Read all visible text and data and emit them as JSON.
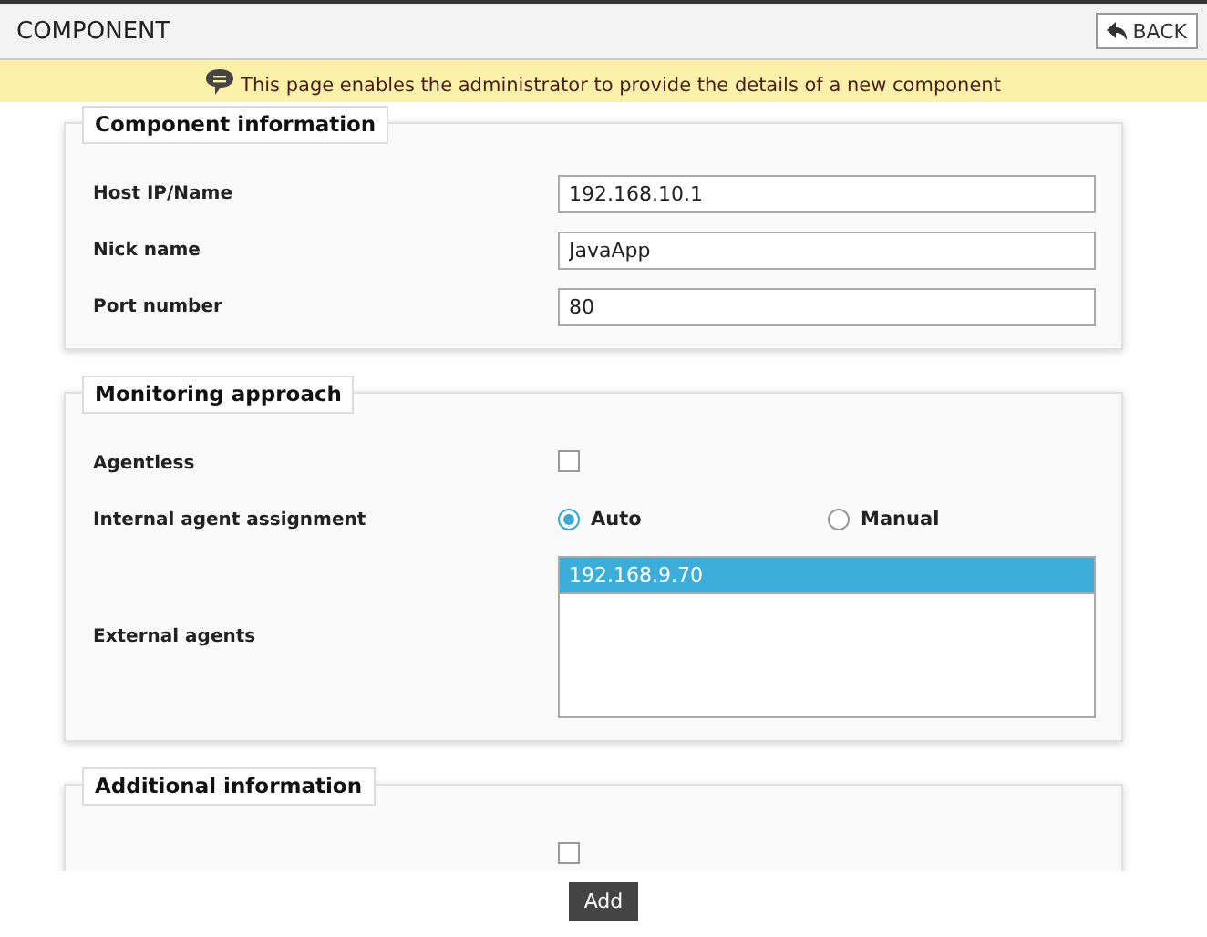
{
  "header": {
    "title": "COMPONENT",
    "back_button": "BACK"
  },
  "banner": {
    "message": "This page enables the administrator to provide the details of a new component"
  },
  "sections": [
    {
      "title": "Component information",
      "rows": [
        {
          "kind": "text",
          "label": "Host IP/Name",
          "value": "192.168.10.1"
        },
        {
          "kind": "text",
          "label": "Nick name",
          "value": "JavaApp"
        },
        {
          "kind": "text",
          "label": "Port number",
          "value": "80"
        }
      ]
    },
    {
      "title": "Monitoring approach",
      "rows": [
        {
          "kind": "checkbox",
          "label": "Agentless",
          "checked": false
        },
        {
          "kind": "radio",
          "label": "Internal agent assignment",
          "options": [
            {
              "label": "Auto",
              "selected": true
            },
            {
              "label": "Manual",
              "selected": false
            }
          ]
        },
        {
          "kind": "list",
          "label": "External agents",
          "items": [
            {
              "label": "192.168.9.70",
              "selected": true
            }
          ]
        }
      ]
    },
    {
      "title": "Additional information",
      "rows": [
        {
          "kind": "checkbox",
          "checked": false
        }
      ]
    }
  ],
  "footer": {
    "add_button": "Add"
  }
}
